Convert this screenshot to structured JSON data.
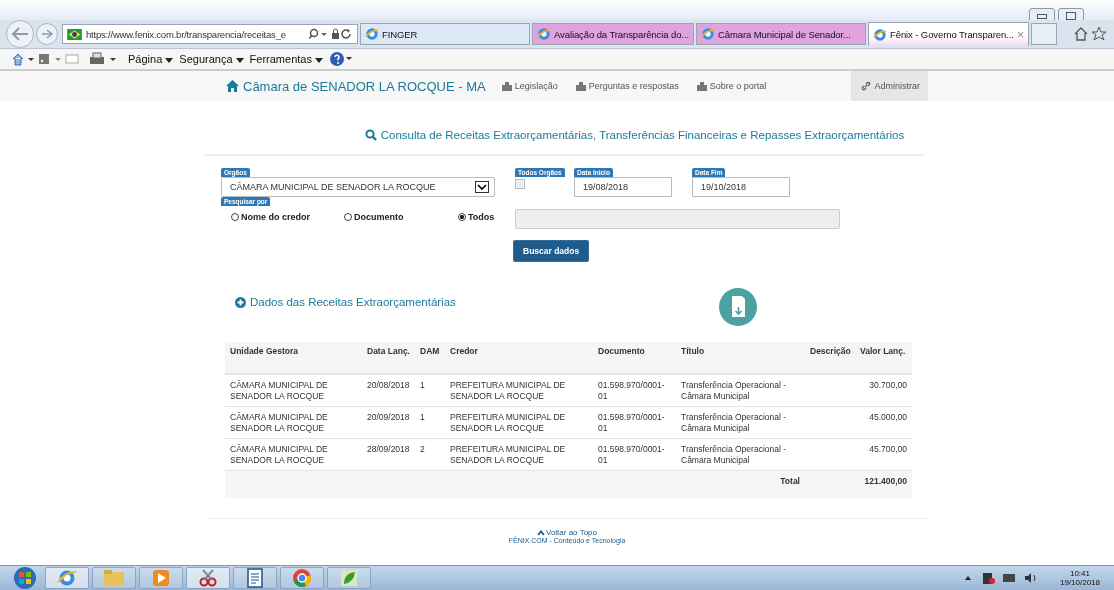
{
  "browser": {
    "address": "https://www.fenix.com.br/transparencia/receitas_e",
    "tabs": [
      {
        "title": "FINGER",
        "selected": false,
        "color": "#dce8f5"
      },
      {
        "title": "Avaliação da Transparência do...",
        "selected": false,
        "color": "#dfa3e0"
      },
      {
        "title": "Câmara Municipal de Senador...",
        "selected": false,
        "color": "#dfa3e0"
      },
      {
        "title": "Fênix - Governo Transparen...",
        "selected": true,
        "color": "#f3d6f3"
      }
    ],
    "close_tab": "×",
    "menus": [
      "Página",
      "Segurança",
      "Ferramentas"
    ]
  },
  "site_nav": {
    "title": "Câmara de SENADOR LA ROCQUE - MA",
    "links": [
      "Legislação",
      "Perguntas e respostas",
      "Sobre o portal"
    ],
    "admin": "Administrar"
  },
  "page_title": "Consulta de Receitas Extraorçamentárias, Transferências Financeiras e Repasses Extraorçamentários",
  "form": {
    "orgaos": {
      "label": "Orgãos",
      "value": "CÂMARA MUNICIPAL DE SENADOR LA ROCQUE"
    },
    "todos_orgaos": {
      "label": "Todos Orgãos",
      "checked": false
    },
    "data_inicio": {
      "label": "Data Inicio",
      "value": "19/08/2018"
    },
    "data_fim": {
      "label": "Data Fim",
      "value": "19/10/2018"
    },
    "pesquisar_por": {
      "label": "Pesquisar por",
      "options": [
        {
          "label": "Nome do credor",
          "selected": false
        },
        {
          "label": "Documento",
          "selected": false
        },
        {
          "label": "Todos",
          "selected": true
        }
      ]
    },
    "button": "Buscar dados"
  },
  "section_title": "Dados das Receitas Extraorçamentárias",
  "table": {
    "columns": [
      "Unidade Gestora",
      "Data Lanç.",
      "DAM",
      "Credor",
      "Documento",
      "Título",
      "Descrição",
      "Valor Lanç."
    ],
    "rows": [
      [
        "CÂMARA MUNICIPAL DE SENADOR LA ROCQUE",
        "20/08/2018",
        "1",
        "PREFEITURA MUNICIPAL DE SENADOR LA ROCQUE",
        "01.598.970/0001-01",
        "Transferência Operacional - Câmara Municipal",
        "",
        "30.700,00"
      ],
      [
        "CÂMARA MUNICIPAL DE SENADOR LA ROCQUE",
        "20/09/2018",
        "1",
        "PREFEITURA MUNICIPAL DE SENADOR LA ROCQUE",
        "01.598.970/0001-01",
        "Transferência Operacional - Câmara Municipal",
        "",
        "45.000,00"
      ],
      [
        "CÂMARA MUNICIPAL DE SENADOR LA ROCQUE",
        "28/09/2018",
        "2",
        "PREFEITURA MUNICIPAL DE SENADOR LA ROCQUE",
        "01.598.970/0001-01",
        "Transferência Operacional - Câmara Municipal",
        "",
        "45.700,00"
      ]
    ],
    "total_label": "Total",
    "total": "121.400,00"
  },
  "footer": {
    "link": "Voltar ao Topo",
    "credit": "FÊNIX.COM - Conteúdo e Tecnologia"
  },
  "taskbar": {
    "time": "10:41",
    "date": "19/10/2018"
  }
}
